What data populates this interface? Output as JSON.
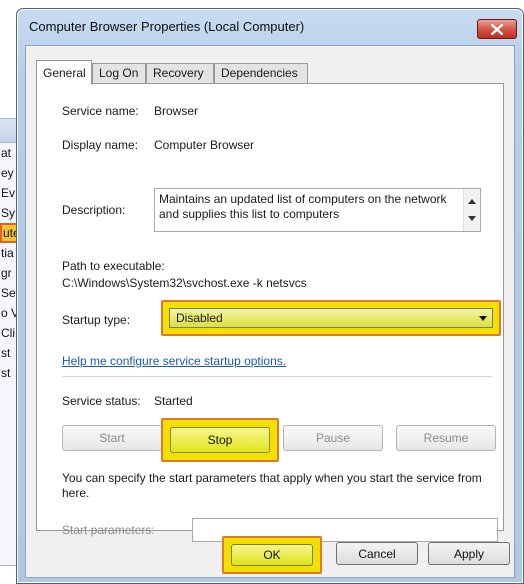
{
  "background_list": {
    "rows": [
      "at",
      "ey",
      "Ev",
      "Sy",
      "ute",
      "tia",
      "gr",
      "Se",
      "o V",
      "Cli",
      "st",
      "st"
    ],
    "selected_index": 4
  },
  "dialog": {
    "title": "Computer Browser Properties (Local Computer)",
    "tabs": [
      {
        "label": "General",
        "active": true
      },
      {
        "label": "Log On",
        "active": false
      },
      {
        "label": "Recovery",
        "active": false
      },
      {
        "label": "Dependencies",
        "active": false
      }
    ],
    "service_name_label": "Service name:",
    "service_name_value": "Browser",
    "display_name_label": "Display name:",
    "display_name_value": "Computer Browser",
    "description_label": "Description:",
    "description_value": "Maintains an updated list of computers on the network and supplies this list to computers",
    "path_label": "Path to executable:",
    "path_value": "C:\\Windows\\System32\\svchost.exe -k netsvcs",
    "startup_type_label": "Startup type:",
    "startup_type_value": "Disabled",
    "help_link": "Help me configure service startup options.",
    "service_status_label": "Service status:",
    "service_status_value": "Started",
    "buttons": {
      "start": "Start",
      "stop": "Stop",
      "pause": "Pause",
      "resume": "Resume"
    },
    "info_text": "You can specify the start parameters that apply when you start the service from here.",
    "start_parameters_label": "Start parameters:",
    "start_parameters_value": "",
    "footer": {
      "ok": "OK",
      "cancel": "Cancel",
      "apply": "Apply"
    }
  },
  "colors": {
    "highlight_fill": "#f2e100",
    "highlight_border": "#e07a2a",
    "link": "#1a59b4",
    "close_button": "#c02c1f"
  },
  "icons": {
    "close": "close-x-icon",
    "dropdown": "chevron-down-icon",
    "scroll_up": "scroll-up-arrow-icon",
    "scroll_down": "scroll-down-arrow-icon"
  }
}
